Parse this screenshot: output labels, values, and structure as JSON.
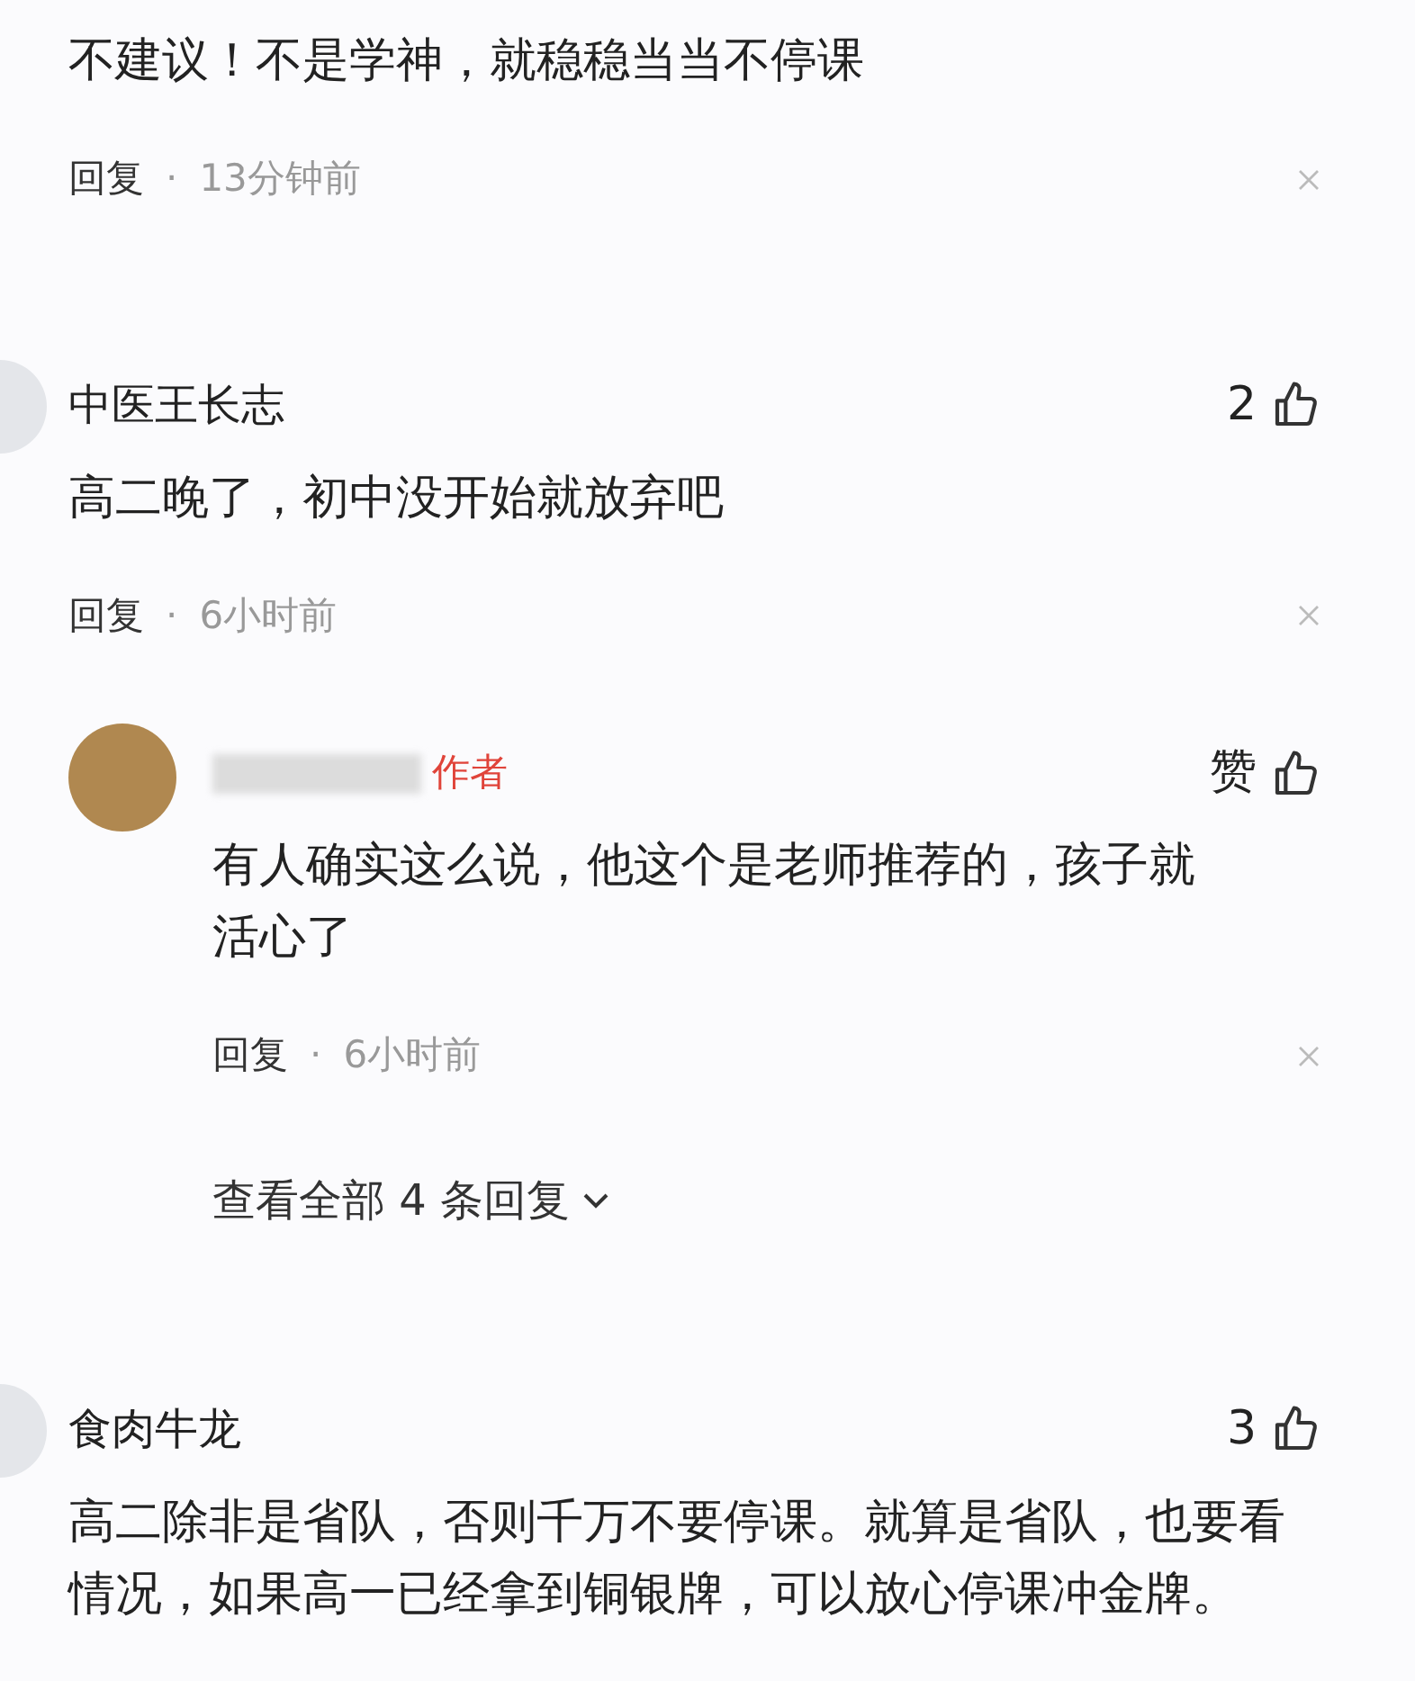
{
  "comments": [
    {
      "body": "不建议！不是学神，就稳稳当当不停课",
      "reply_label": "回复",
      "separator": "·",
      "time": "13分钟前"
    },
    {
      "username": "中医王长志",
      "likes": "2",
      "body": "高二晚了，初中没开始就放弃吧",
      "reply_label": "回复",
      "separator": "·",
      "time": "6小时前",
      "replies": [
        {
          "author_tag": "作者",
          "likes": "赞",
          "body": "有人确实这么说，他这个是老师推荐的，孩子就活心了",
          "reply_label": "回复",
          "separator": "·",
          "time": "6小时前"
        }
      ],
      "view_all": "查看全部 4 条回复"
    },
    {
      "username": "食肉牛龙",
      "likes": "3",
      "body": "高二除非是省队，否则千万不要停课。就算是省队，也要看情况，如果高一已经拿到铜银牌，可以放心停课冲金牌。"
    }
  ]
}
